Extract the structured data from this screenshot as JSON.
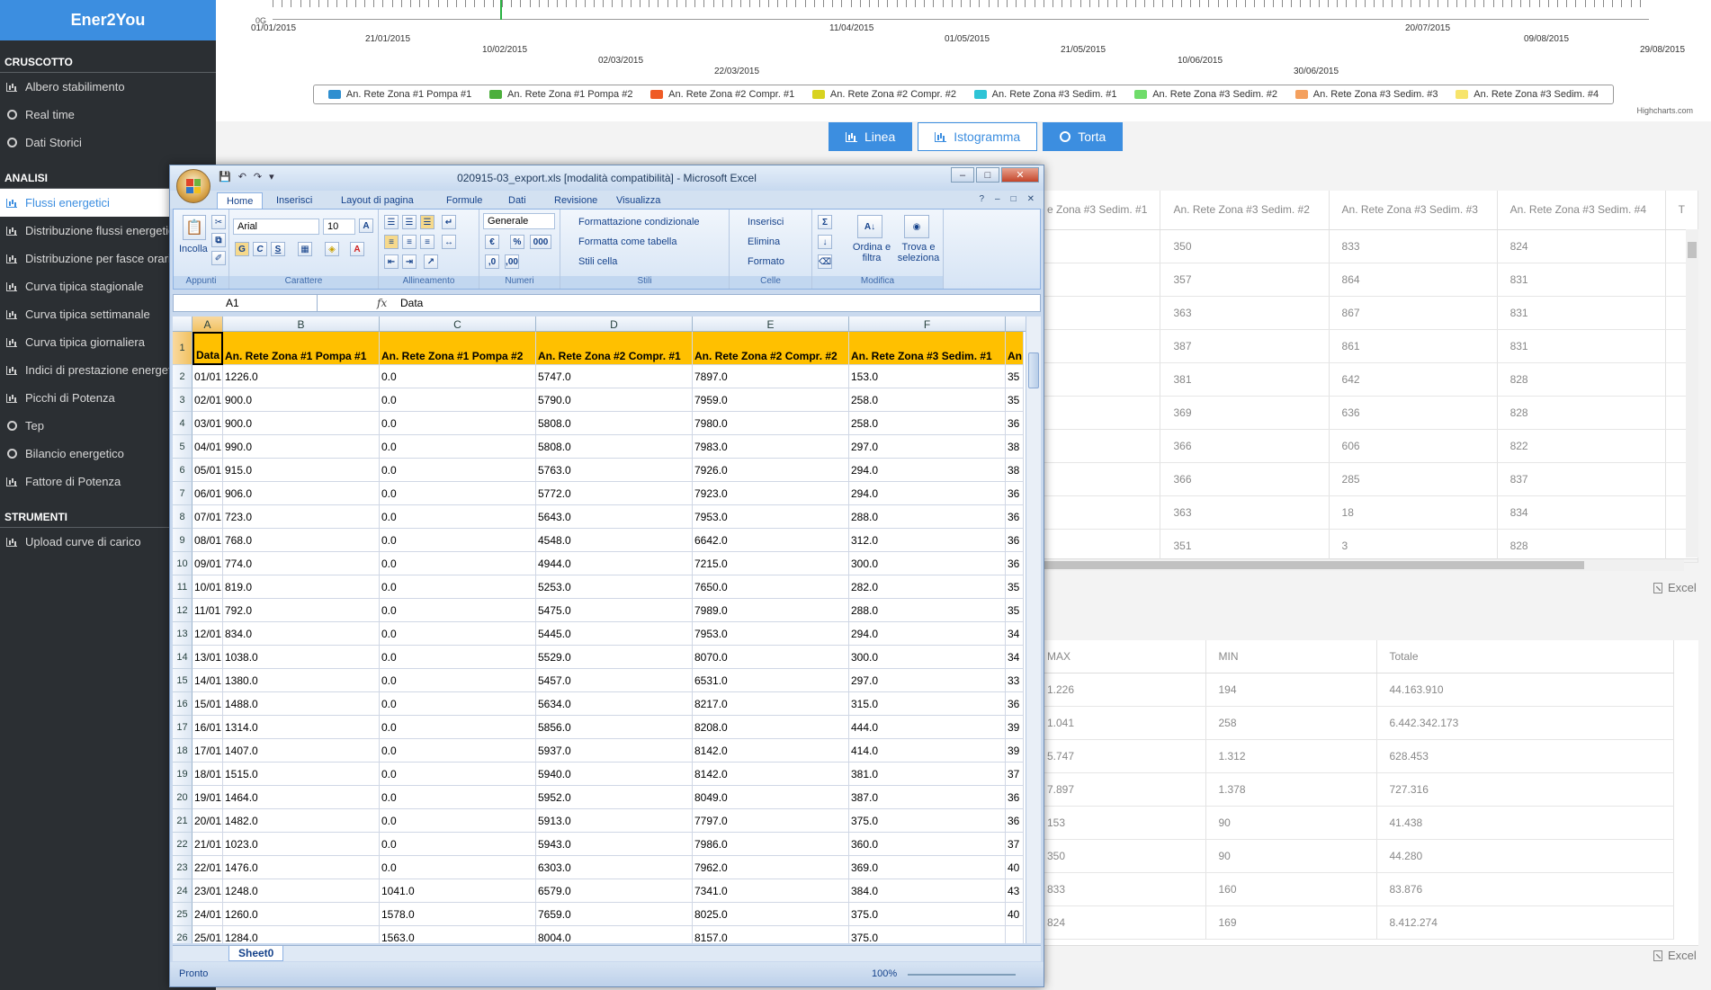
{
  "sidebar": {
    "brand": "Ener2You",
    "sections": [
      {
        "title": "CRUSCOTTO",
        "items": [
          {
            "label": "Albero stabilimento",
            "icon": "bar-chart-icon",
            "active": false
          },
          {
            "label": "Real time",
            "icon": "circle-icon",
            "active": false
          },
          {
            "label": "Dati Storici",
            "icon": "circle-icon",
            "active": false
          }
        ]
      },
      {
        "title": "ANALISI",
        "items": [
          {
            "label": "Flussi energetici",
            "icon": "bar-chart-icon",
            "active": true
          },
          {
            "label": "Distribuzione flussi energetici",
            "icon": "bar-chart-icon",
            "active": false
          },
          {
            "label": "Distribuzione per fasce orarie",
            "icon": "bar-chart-icon",
            "active": false
          },
          {
            "label": "Curva tipica stagionale",
            "icon": "bar-chart-icon",
            "active": false
          },
          {
            "label": "Curva tipica settimanale",
            "icon": "bar-chart-icon",
            "active": false
          },
          {
            "label": "Curva tipica giornaliera",
            "icon": "bar-chart-icon",
            "active": false
          },
          {
            "label": "Indici di prestazione energetica",
            "icon": "signal-bars-icon",
            "active": false
          },
          {
            "label": "Picchi di Potenza",
            "icon": "bar-chart-icon",
            "active": false
          },
          {
            "label": "Tep",
            "icon": "circle-icon",
            "active": false
          },
          {
            "label": "Bilancio energetico",
            "icon": "circle-icon",
            "active": false
          },
          {
            "label": "Fattore di Potenza",
            "icon": "bar-chart-icon",
            "active": false
          }
        ]
      },
      {
        "title": "STRUMENTI",
        "items": [
          {
            "label": "Upload curve di carico",
            "icon": "bar-chart-icon",
            "active": false
          }
        ]
      }
    ]
  },
  "chart": {
    "timeline_zero": "0G",
    "dates_top": [
      "01/01/2015",
      "11/04/2015",
      "20/07/2015"
    ],
    "dates": [
      "21/01/2015",
      "10/02/2015",
      "02/03/2015",
      "22/03/2015",
      "01/05/2015",
      "21/05/2015",
      "10/06/2015",
      "30/06/2015",
      "09/08/2015",
      "29/08/2015"
    ],
    "legend": [
      {
        "name": "An. Rete Zona #1 Pompa #1",
        "color": "#2f8fd0"
      },
      {
        "name": "An. Rete Zona #1 Pompa #2",
        "color": "#4caf3c"
      },
      {
        "name": "An. Rete Zona #2 Compr. #1",
        "color": "#ef5b26"
      },
      {
        "name": "An. Rete Zona #2 Compr. #2",
        "color": "#d8d320"
      },
      {
        "name": "An. Rete Zona #3 Sedim. #1",
        "color": "#2ec4d6"
      },
      {
        "name": "An. Rete Zona #3 Sedim. #2",
        "color": "#6fdc6a"
      },
      {
        "name": "An. Rete Zona #3 Sedim. #3",
        "color": "#f4a05e"
      },
      {
        "name": "An. Rete Zona #3 Sedim. #4",
        "color": "#f7e46b"
      }
    ],
    "credit": "Highcharts.com",
    "buttons": {
      "line": "Linea",
      "histogram": "Istogramma",
      "pie": "Torta"
    }
  },
  "data_table": {
    "headers": [
      "e Zona #3 Sedim. #1",
      "An. Rete Zona #3 Sedim. #2",
      "An. Rete Zona #3 Sedim. #3",
      "An. Rete Zona #3 Sedim. #4",
      "T"
    ],
    "rows": [
      [
        "",
        "350",
        "833",
        "824",
        ""
      ],
      [
        "",
        "357",
        "864",
        "831",
        ""
      ],
      [
        "",
        "363",
        "867",
        "831",
        ""
      ],
      [
        "",
        "387",
        "861",
        "831",
        ""
      ],
      [
        "",
        "381",
        "642",
        "828",
        ""
      ],
      [
        "",
        "369",
        "636",
        "828",
        ""
      ],
      [
        "",
        "366",
        "606",
        "822",
        ""
      ],
      [
        "",
        "366",
        "285",
        "837",
        ""
      ],
      [
        "",
        "363",
        "18",
        "834",
        ""
      ],
      [
        "",
        "351",
        "3",
        "828",
        ""
      ]
    ],
    "excel_label": "Excel"
  },
  "summary_table": {
    "headers": [
      "MAX",
      "MIN",
      "Totale"
    ],
    "rows": [
      [
        "1.226",
        "194",
        "44.163.910"
      ],
      [
        "1.041",
        "258",
        "6.442.342.173"
      ],
      [
        "5.747",
        "1.312",
        "628.453"
      ],
      [
        "7.897",
        "1.378",
        "727.316"
      ],
      [
        "153",
        "90",
        "41.438"
      ],
      [
        "350",
        "90",
        "44.280"
      ],
      [
        "833",
        "160",
        "83.876"
      ],
      [
        "824",
        "169",
        "8.412.274"
      ]
    ],
    "excel_label": "Excel"
  },
  "excel": {
    "title": "020915-03_export.xls  [modalità compatibilità] - Microsoft Excel",
    "tabs": [
      "Home",
      "Inserisci",
      "Layout di pagina",
      "Formule",
      "Dati",
      "Revisione",
      "Visualizza"
    ],
    "ribbon": {
      "paste": "Incolla",
      "font_name": "Arial",
      "font_size": "10",
      "bold": "G",
      "italic": "C",
      "underline": "S",
      "number_format": "Generale",
      "cond_format": "Formattazione condizionale",
      "format_table": "Formatta come tabella",
      "cell_styles": "Stili cella",
      "insert": "Inserisci",
      "delete": "Elimina",
      "format": "Formato",
      "sort_filter": "Ordina e filtra",
      "find_select": "Trova e seleziona",
      "groups": [
        "Appunti",
        "Carattere",
        "Allineamento",
        "Numeri",
        "Stili",
        "Celle",
        "Modifica"
      ]
    },
    "name_box": "A1",
    "formula_value": "Data",
    "columns": [
      "A",
      "B",
      "C",
      "D",
      "E",
      "F"
    ],
    "header_row": [
      "Data",
      "An. Rete Zona #1 Pompa #1",
      "An. Rete Zona #1 Pompa #2",
      "An. Rete Zona #2 Compr. #1",
      "An. Rete Zona #2 Compr. #2",
      "An. Rete Zona #3  Sedim. #1",
      "An"
    ],
    "rows": [
      [
        "01/01",
        "1226.0",
        "0.0",
        "5747.0",
        "7897.0",
        "153.0",
        "35"
      ],
      [
        "02/01",
        "900.0",
        "0.0",
        "5790.0",
        "7959.0",
        "258.0",
        "35"
      ],
      [
        "03/01",
        "900.0",
        "0.0",
        "5808.0",
        "7980.0",
        "258.0",
        "36"
      ],
      [
        "04/01",
        "990.0",
        "0.0",
        "5808.0",
        "7983.0",
        "297.0",
        "38"
      ],
      [
        "05/01",
        "915.0",
        "0.0",
        "5763.0",
        "7926.0",
        "294.0",
        "38"
      ],
      [
        "06/01",
        "906.0",
        "0.0",
        "5772.0",
        "7923.0",
        "294.0",
        "36"
      ],
      [
        "07/01",
        "723.0",
        "0.0",
        "5643.0",
        "7953.0",
        "288.0",
        "36"
      ],
      [
        "08/01",
        "768.0",
        "0.0",
        "4548.0",
        "6642.0",
        "312.0",
        "36"
      ],
      [
        "09/01",
        "774.0",
        "0.0",
        "4944.0",
        "7215.0",
        "300.0",
        "36"
      ],
      [
        "10/01",
        "819.0",
        "0.0",
        "5253.0",
        "7650.0",
        "282.0",
        "35"
      ],
      [
        "11/01",
        "792.0",
        "0.0",
        "5475.0",
        "7989.0",
        "288.0",
        "35"
      ],
      [
        "12/01",
        "834.0",
        "0.0",
        "5445.0",
        "7953.0",
        "294.0",
        "34"
      ],
      [
        "13/01",
        "1038.0",
        "0.0",
        "5529.0",
        "8070.0",
        "300.0",
        "34"
      ],
      [
        "14/01",
        "1380.0",
        "0.0",
        "5457.0",
        "6531.0",
        "297.0",
        "33"
      ],
      [
        "15/01",
        "1488.0",
        "0.0",
        "5634.0",
        "8217.0",
        "315.0",
        "36"
      ],
      [
        "16/01",
        "1314.0",
        "0.0",
        "5856.0",
        "8208.0",
        "444.0",
        "39"
      ],
      [
        "17/01",
        "1407.0",
        "0.0",
        "5937.0",
        "8142.0",
        "414.0",
        "39"
      ],
      [
        "18/01",
        "1515.0",
        "0.0",
        "5940.0",
        "8142.0",
        "381.0",
        "37"
      ],
      [
        "19/01",
        "1464.0",
        "0.0",
        "5952.0",
        "8049.0",
        "387.0",
        "36"
      ],
      [
        "20/01",
        "1482.0",
        "0.0",
        "5913.0",
        "7797.0",
        "375.0",
        "36"
      ],
      [
        "21/01",
        "1023.0",
        "0.0",
        "5943.0",
        "7986.0",
        "360.0",
        "37"
      ],
      [
        "22/01",
        "1476.0",
        "0.0",
        "6303.0",
        "7962.0",
        "369.0",
        "40"
      ],
      [
        "23/01",
        "1248.0",
        "1041.0",
        "6579.0",
        "7341.0",
        "384.0",
        "43"
      ],
      [
        "24/01",
        "1260.0",
        "1578.0",
        "7659.0",
        "8025.0",
        "375.0",
        "40"
      ],
      [
        "25/01",
        "1284.0",
        "1563.0",
        "8004.0",
        "8157.0",
        "375.0",
        ""
      ]
    ],
    "sheet_tab": "Sheet0",
    "status": "Pronto",
    "zoom": "100%"
  }
}
